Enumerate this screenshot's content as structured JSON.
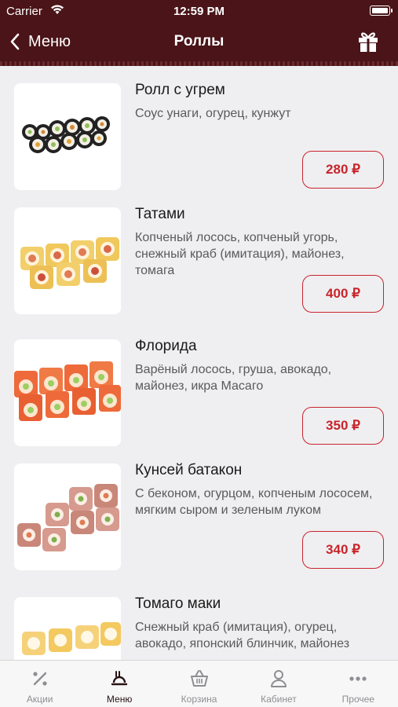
{
  "status_bar": {
    "carrier": "Carrier",
    "time": "12:59 PM"
  },
  "nav": {
    "back_label": "Меню",
    "title": "Роллы",
    "gift_icon": "gift-icon"
  },
  "colors": {
    "header_bg": "#4a1418",
    "accent": "#c8242b",
    "background": "#efeff1"
  },
  "items": [
    {
      "title": "Ролл с угрем",
      "description": "Соус унаги, огурец, кунжут",
      "price": "280 ₽"
    },
    {
      "title": "Татами",
      "description": "Копченый лосось, копченый угорь, снежный краб (имитация), майонез, томага",
      "price": "400 ₽"
    },
    {
      "title": "Флорида",
      "description": "Варёный лосось, груша, авокадо, майонез, икра Масаго",
      "price": "350 ₽"
    },
    {
      "title": "Кунсей батакон",
      "description": "С беконом, огурцом, копченым лососем, мягким сыром и зеленым луком",
      "price": "340 ₽"
    },
    {
      "title": "Томаго маки",
      "description": "Снежный краб (имитация), огурец, авокадо, японский блинчик, майонез",
      "price": ""
    }
  ],
  "tabs": [
    {
      "label": "Акции",
      "icon": "percent-icon",
      "active": false
    },
    {
      "label": "Меню",
      "icon": "menu-food-icon",
      "active": true
    },
    {
      "label": "Корзина",
      "icon": "basket-icon",
      "active": false
    },
    {
      "label": "Кабинет",
      "icon": "user-icon",
      "active": false
    },
    {
      "label": "Прочее",
      "icon": "more-icon",
      "active": false
    }
  ]
}
